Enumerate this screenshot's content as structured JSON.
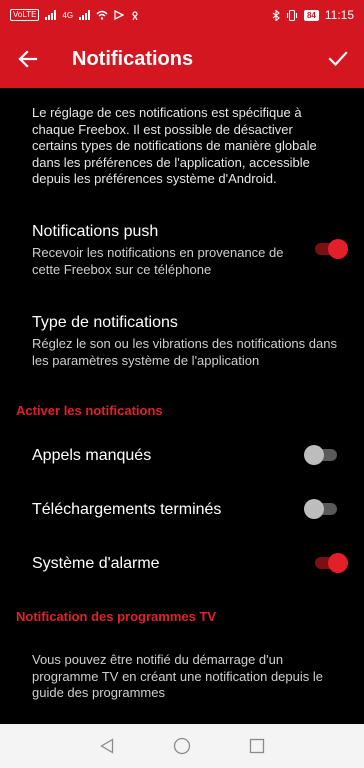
{
  "status_bar": {
    "network_badge": "VoLTE",
    "network_type": "4G",
    "battery": "84",
    "time": "11:15"
  },
  "app_bar": {
    "title": "Notifications",
    "back_icon": "arrow-left-icon",
    "confirm_icon": "check-icon"
  },
  "intro_text": "Le réglage de ces notifications est spécifique à chaque Freebox. Il est possible de désactiver certains types de notifications de manière globale dans les préférences de l'application, accessible depuis les préférences système d'Android.",
  "push": {
    "title": "Notifications push",
    "subtitle": "Recevoir les notifications en provenance de cette Freebox sur ce téléphone",
    "enabled": true
  },
  "type_notifications": {
    "title": "Type de notifications",
    "subtitle": "Réglez le son ou les vibrations des notifications dans les paramètres système de l'application"
  },
  "section_activate": {
    "header": "Activer les notifications",
    "items": [
      {
        "label": "Appels manqués",
        "enabled": false
      },
      {
        "label": "Téléchargements terminés",
        "enabled": false
      },
      {
        "label": "Système d'alarme",
        "enabled": true
      }
    ]
  },
  "section_tv": {
    "header": "Notification des programmes TV",
    "text": "Vous pouvez être notifié du démarrage d'un programme TV en créant une notification depuis le guide des programmes"
  },
  "colors": {
    "accent": "#d3161f",
    "switch_on": "#e3202a",
    "background": "#000000"
  },
  "nav_bar": {
    "back_icon": "triangle-back-icon",
    "home_icon": "circle-home-icon",
    "recents_icon": "square-recents-icon"
  }
}
